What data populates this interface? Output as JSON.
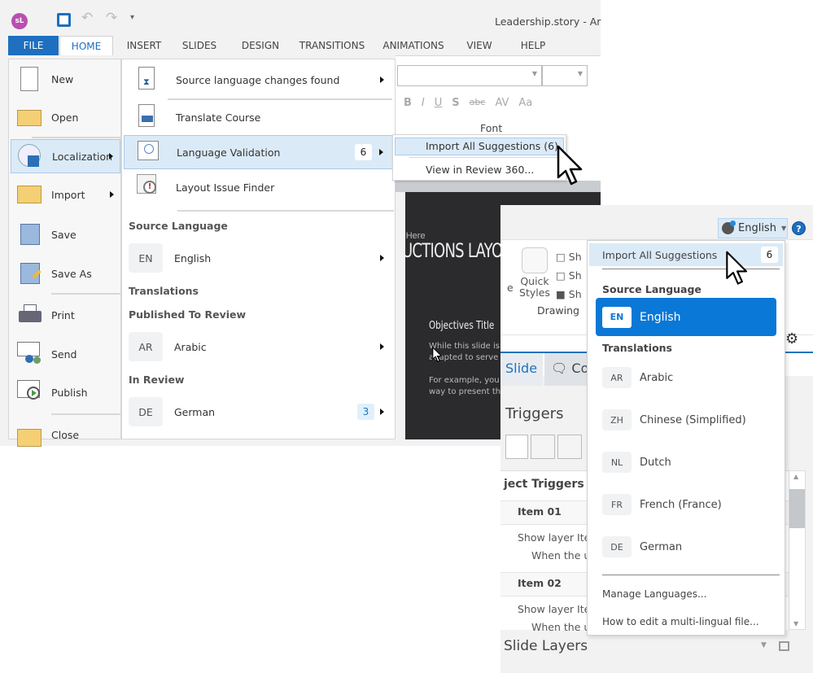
{
  "app": {
    "logo": "sL",
    "title": "Leadership.story - Ar"
  },
  "tabs": [
    "FILE",
    "HOME",
    "INSERT",
    "SLIDES",
    "DESIGN",
    "TRANSITIONS",
    "ANIMATIONS",
    "VIEW",
    "HELP"
  ],
  "ribbon": {
    "font_group": "Font",
    "format_buttons": [
      "B",
      "I",
      "U",
      "S",
      "abc",
      "AV",
      "Aa"
    ],
    "drawing_group": "Drawing",
    "quick_styles": "Quick Styles",
    "shape_labels": [
      "Sh",
      "Sh",
      "Sh"
    ],
    "cut_label": "e"
  },
  "file_menu": [
    "New",
    "Open",
    "Localization",
    "Import",
    "Save",
    "Save As",
    "Print",
    "Send",
    "Publish",
    "Close"
  ],
  "localization_menu": {
    "items": [
      "Source language changes found",
      "Translate Course",
      "Language Validation",
      "Layout Issue Finder"
    ],
    "validation_count": "6",
    "source_header": "Source Language",
    "source": {
      "code": "EN",
      "name": "English"
    },
    "translations_header": "Translations",
    "published_header": "Published To Review",
    "published": [
      {
        "code": "AR",
        "name": "Arabic"
      }
    ],
    "review_header": "In Review",
    "review": [
      {
        "code": "DE",
        "name": "German",
        "count": "3"
      }
    ]
  },
  "validation_submenu": [
    "Import All Suggestions (6)",
    "View in Review 360..."
  ],
  "slide": {
    "subtitle": "r Here",
    "title": "UCTIONS LAYOU",
    "objectives": "Objectives Title",
    "line1": "While this slide is",
    "line2": "adapted to serve a",
    "line3": "For example, you c",
    "line4": "way to present th"
  },
  "language_button": "English",
  "language_dropdown": {
    "import_label": "Import All Suggestions",
    "import_count": "6",
    "source_header": "Source Language",
    "source": {
      "code": "EN",
      "name": "English"
    },
    "translations_header": "Translations",
    "translations": [
      {
        "code": "AR",
        "name": "Arabic"
      },
      {
        "code": "ZH",
        "name": "Chinese (Simplified)"
      },
      {
        "code": "NL",
        "name": "Dutch"
      },
      {
        "code": "FR",
        "name": "French (France)"
      },
      {
        "code": "DE",
        "name": "German"
      }
    ],
    "manage": "Manage Languages...",
    "help": "How to edit a multi-lingual file..."
  },
  "panel": {
    "tab_slide": "Slide",
    "tab_comments": "Co",
    "triggers": "Triggers",
    "object_triggers": "ject Triggers",
    "item1": "Item 01",
    "item1_action": "Show layer Ite",
    "item1_when": "When the u",
    "item2": "Item 02",
    "item2_action": "Show layer Ite",
    "item2_when": "When the u",
    "slide_layers": "Slide Layers"
  },
  "colors": {
    "accent": "#1e73be",
    "selected": "#0a78d7",
    "hover": "#dbeaf7"
  }
}
